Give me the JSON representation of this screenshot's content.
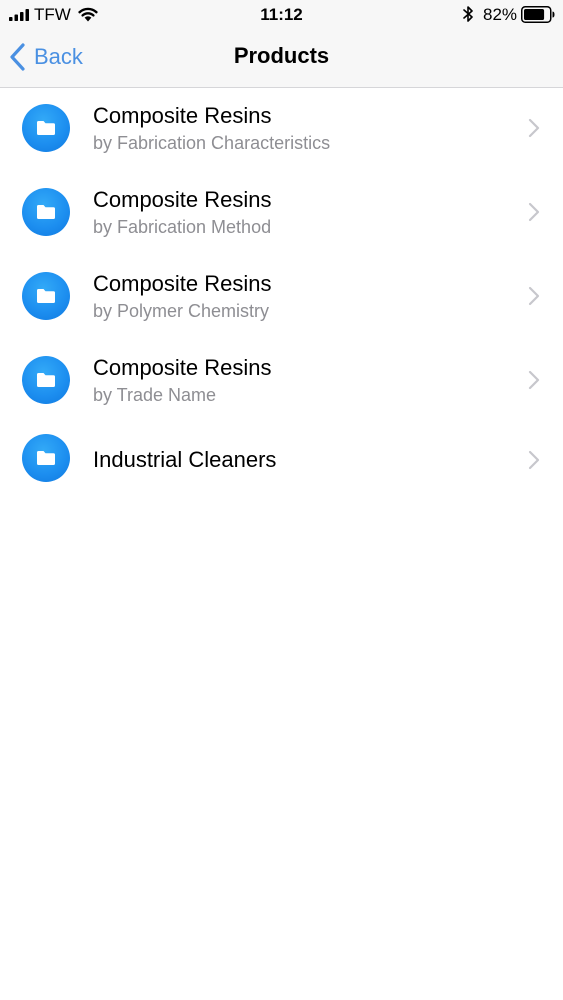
{
  "status_bar": {
    "carrier": "TFW",
    "time": "11:12",
    "battery_percent": "82%",
    "battery_level": 0.82,
    "signal_bars": 4,
    "icons": [
      "signal-icon",
      "wifi-icon",
      "bluetooth-icon",
      "battery-icon"
    ]
  },
  "nav": {
    "back_label": "Back",
    "title": "Products",
    "back_icon": "chevron-left-icon"
  },
  "colors": {
    "accent": "#4a90e2",
    "icon_blue": "#1d8ff0",
    "subtitle_gray": "#8e8e93",
    "chevron_gray": "#c7c7cc",
    "nav_background": "#f7f7f7"
  },
  "list": {
    "item_icon": "folder-icon",
    "accessory_icon": "chevron-right-icon",
    "items": [
      {
        "title": "Composite Resins",
        "subtitle": "by Fabrication Characteristics"
      },
      {
        "title": "Composite Resins",
        "subtitle": "by Fabrication Method"
      },
      {
        "title": "Composite Resins",
        "subtitle": "by Polymer Chemistry"
      },
      {
        "title": "Composite Resins",
        "subtitle": "by Trade Name"
      },
      {
        "title": "Industrial Cleaners"
      }
    ]
  }
}
